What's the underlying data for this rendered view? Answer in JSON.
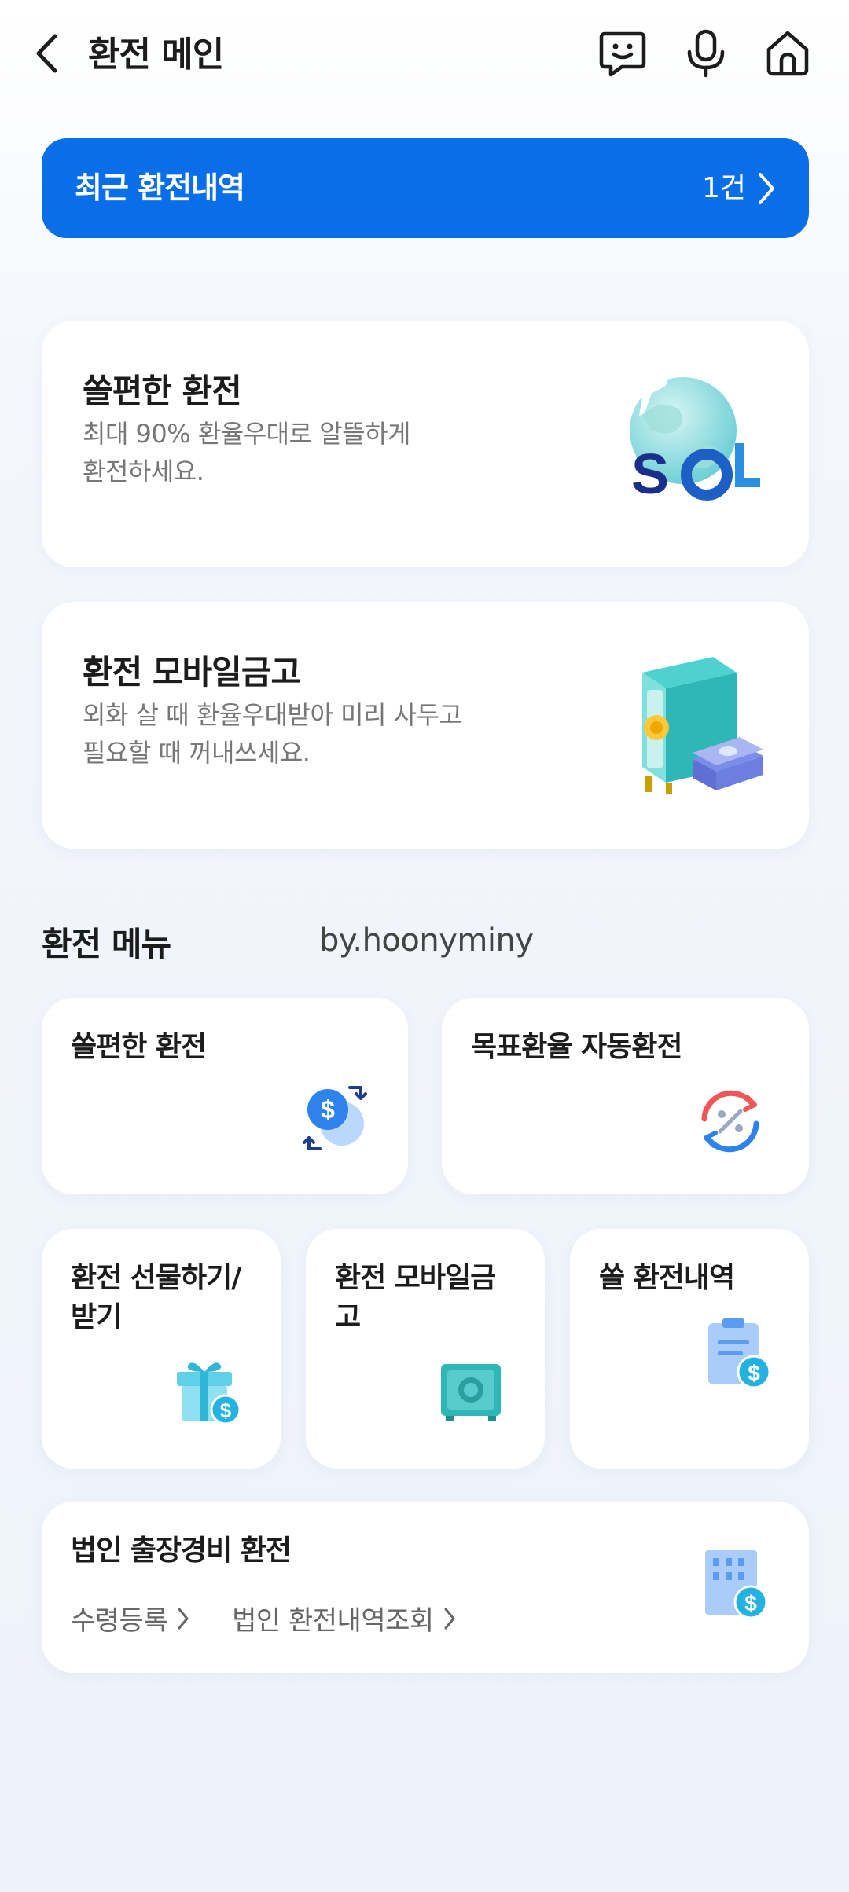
{
  "header": {
    "title": "환전 메인",
    "back_icon": "chevron-left-icon",
    "chat_icon": "chatbot-icon",
    "mic_icon": "microphone-icon",
    "home_icon": "home-icon"
  },
  "recent": {
    "label": "최근 환전내역",
    "count": "1건"
  },
  "promos": [
    {
      "title": "쏠편한 환전",
      "desc_line1": "최대 90% 환율우대로 알뜰하게",
      "desc_line2": "환전하세요.",
      "illustration": "sol-globe-plane",
      "logo_text": "SOL"
    },
    {
      "title": "환전 모바일금고",
      "desc_line1": "외화 살 때 환율우대받아 미리 사두고",
      "desc_line2": "필요할 때 꺼내쓰세요.",
      "illustration": "safe-with-cash"
    }
  ],
  "menu": {
    "section_title": "환전 메뉴",
    "watermark": "by.hoonyminy",
    "items": [
      {
        "label": "쏠편한 환전",
        "icon": "dollar-exchange-icon"
      },
      {
        "label": "목표환율 자동환전",
        "icon": "percent-cycle-icon"
      },
      {
        "label_line1": "환전 선물하기/",
        "label_line2": "받기",
        "icon": "gift-dollar-icon"
      },
      {
        "label_line1": "환전 모바일금",
        "label_line2": "고",
        "icon": "safe-icon"
      },
      {
        "label": "쏠 환전내역",
        "icon": "clipboard-dollar-icon"
      }
    ],
    "corporate": {
      "title": "법인 출장경비 환전",
      "link1": "수령등록",
      "link2": "법인 환전내역조회",
      "icon": "building-dollar-icon"
    }
  },
  "colors": {
    "brand_blue": "#0a6ee8",
    "background": "#eef2fa",
    "card": "#ffffff"
  }
}
